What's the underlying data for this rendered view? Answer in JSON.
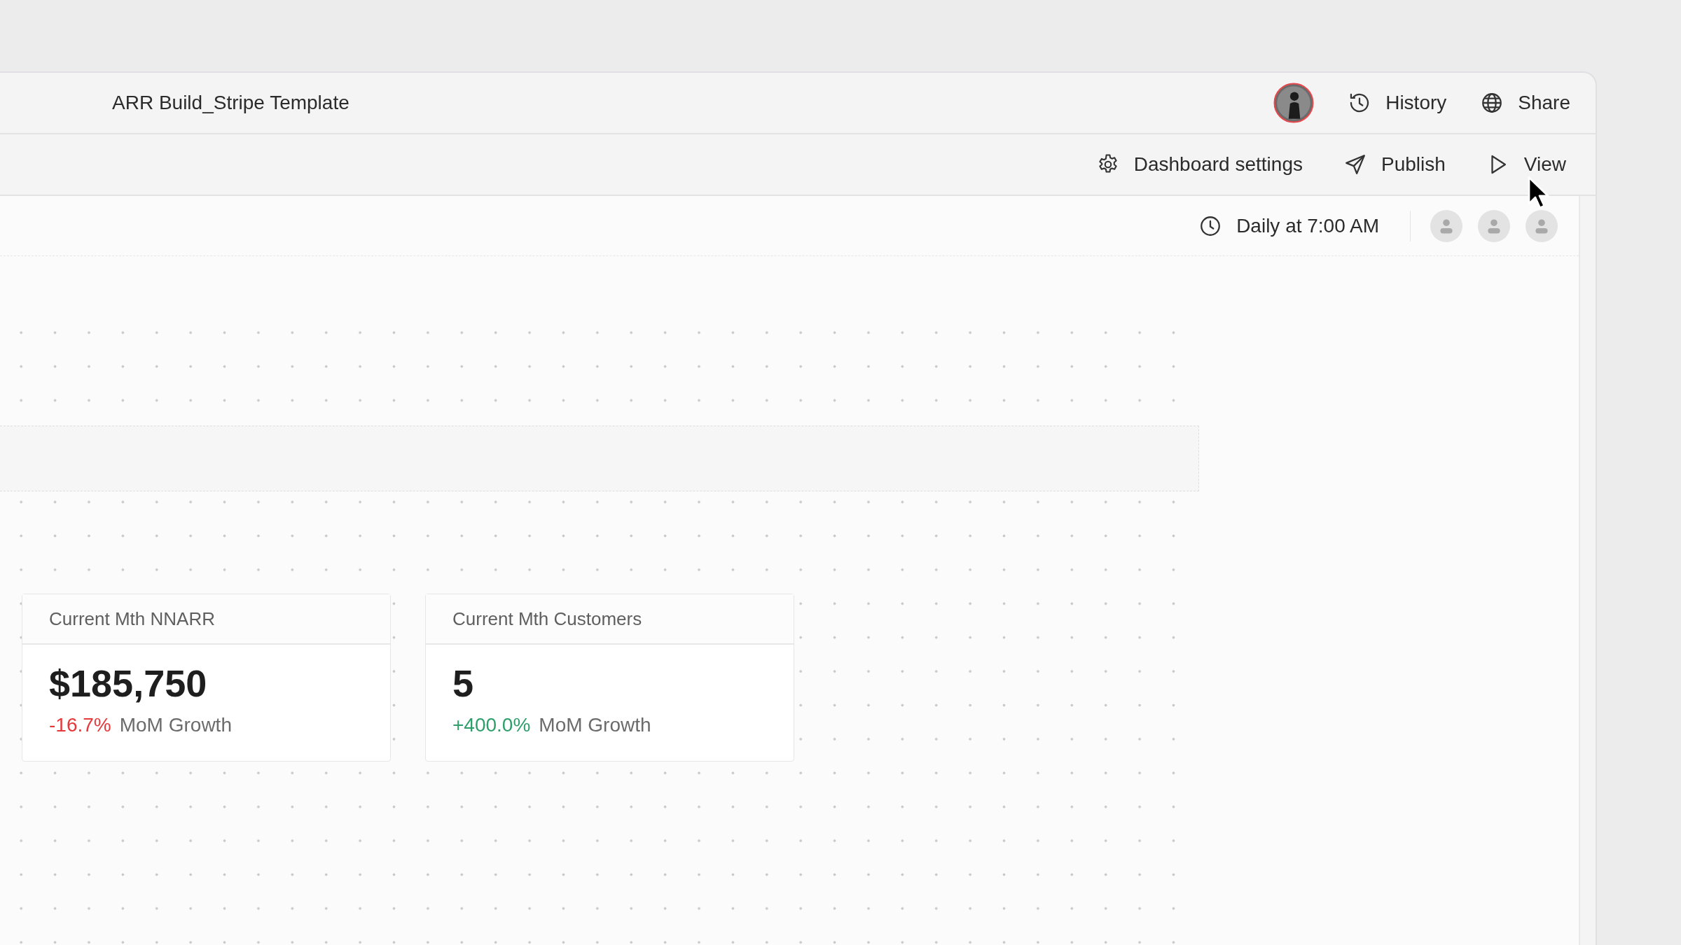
{
  "window": {
    "title": "ARR Build_Stripe Template"
  },
  "header_actions": [
    {
      "kind": "history",
      "label": "History"
    },
    {
      "kind": "share",
      "label": "Share"
    }
  ],
  "toolbar": [
    {
      "kind": "settings",
      "label": "Dashboard settings"
    },
    {
      "kind": "publish",
      "label": "Publish"
    },
    {
      "kind": "view",
      "label": "View"
    }
  ],
  "schedule": {
    "label": "Daily at 7:00 AM"
  },
  "cards": [
    {
      "title": "Current Mth NNARR",
      "value": "$185,750",
      "change": "-16.7%",
      "color": "#e5393c",
      "change_label": "MoM Growth"
    },
    {
      "title": "Current Mth Customers",
      "value": "5",
      "change": "+400.0%",
      "color": "#2e9e6b",
      "change_label": "MoM Growth"
    }
  ]
}
